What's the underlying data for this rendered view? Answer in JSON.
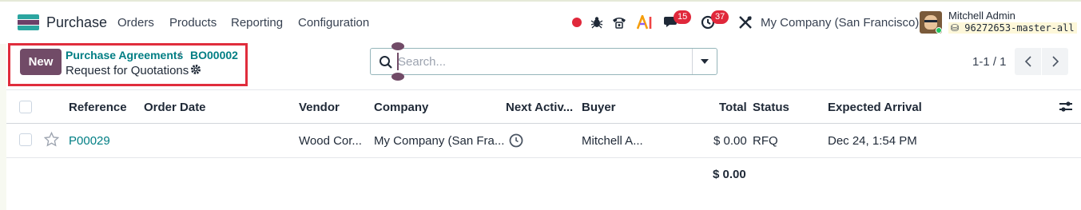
{
  "app": {
    "name": "Purchase"
  },
  "menu": [
    "Orders",
    "Products",
    "Reporting",
    "Configuration"
  ],
  "systray": {
    "messages_count": "15",
    "activities_count": "37",
    "company": "My Company (San Francisco)",
    "user_name": "Mitchell Admin",
    "database": "96272653-master-all"
  },
  "control": {
    "new_label": "New",
    "breadcrumb": [
      "Purchase Agreements",
      "BO00002"
    ],
    "breadcrumb_separator": "/",
    "title": "Request for Quotations",
    "search_placeholder": "Search...",
    "pager": "1-1 / 1"
  },
  "table": {
    "columns": [
      "Reference",
      "Order Date",
      "Vendor",
      "Company",
      "Next Activ...",
      "Buyer",
      "Total",
      "Status",
      "Expected Arrival"
    ],
    "rows": [
      {
        "reference": "P00029",
        "order_date": "",
        "vendor": "Wood Cor...",
        "company": "My Company (San Fra...",
        "buyer": "Mitchell A...",
        "total": "$ 0.00",
        "status": "RFQ",
        "expected_arrival": "Dec 24, 1:54 PM"
      }
    ],
    "footer_total": "$ 0.00"
  },
  "colors": {
    "brand": "#714b67",
    "link": "#017e84",
    "badge": "#e0283b",
    "highlight": "#e02d3c"
  }
}
